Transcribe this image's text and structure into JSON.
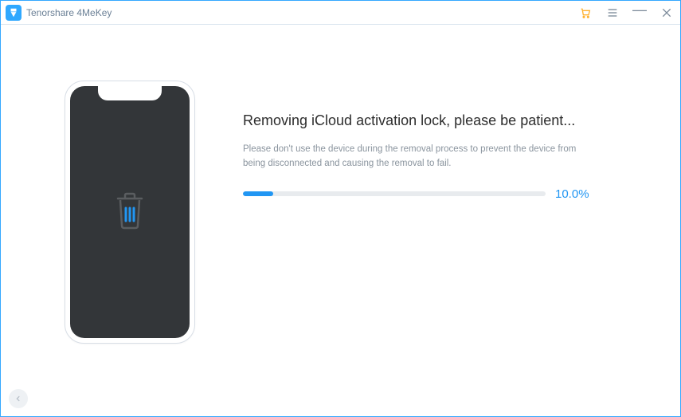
{
  "titlebar": {
    "app_title": "Tenorshare 4MeKey"
  },
  "main": {
    "heading": "Removing iCloud activation lock, please be patient...",
    "subtext": "Please don't use the device during the removal process to prevent the device from being disconnected and causing the removal to fail.",
    "progress_percent": 10,
    "progress_label": "10.0%"
  },
  "icons": {
    "logo": "logo",
    "cart": "cart-icon",
    "menu": "menu-icon",
    "minimize": "minimize-icon",
    "close": "close-icon",
    "trash": "trash-icon",
    "back": "back-arrow-icon"
  },
  "colors": {
    "accent": "#2196f3",
    "border": "#34a8ff",
    "cart": "#ffb12e"
  }
}
